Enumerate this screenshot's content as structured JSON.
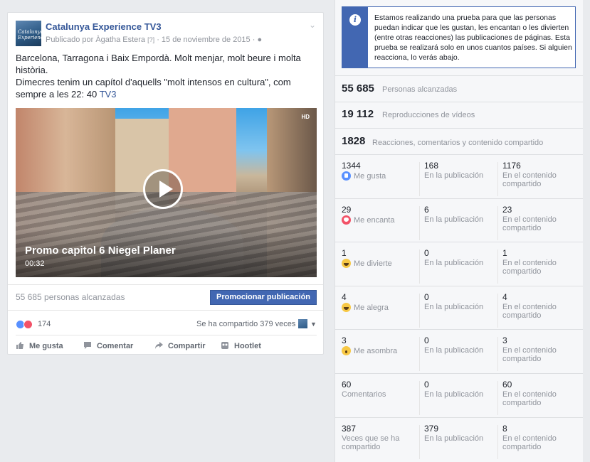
{
  "post": {
    "page_name": "Catalunya Experience TV3",
    "avatar_text": "Catalunya Experience",
    "published_by": "Publicado por Àgatha Estera",
    "date_sep": " · 15 de noviembre de 2015 ·",
    "text_line1": "Barcelona, Tarragona i Baix Empordà. Molt menjar, molt beure i molta història.",
    "text_line2": "Dimecres tenim un capítol d'aquells \"molt intensos en cultura\", com sempre a les 22: 40",
    "text_link": "TV3",
    "video": {
      "title": "Promo capitol 6 Niegel Planer",
      "duration": "00:32",
      "hd_label": "HD"
    },
    "reach_text": "55 685 personas alcanzadas",
    "promote_label": "Promocionar publicación",
    "reaction_count": "174",
    "shared_text": "Se ha compartido 379 veces",
    "actions": {
      "like": "Me gusta",
      "comment": "Comentar",
      "share": "Compartir",
      "hootlet": "Hootlet"
    }
  },
  "notice": {
    "text": "Estamos realizando una prueba para que las personas puedan indicar que les gustan, les encantan o les divierten (entre otras reacciones) las publicaciones de páginas. Esta prueba se realizará solo en unos cuantos países. Si alguien reacciona, lo verás abajo."
  },
  "summary": [
    {
      "value": "55 685",
      "label": "Personas alcanzadas"
    },
    {
      "value": "19 112",
      "label": "Reproducciones de vídeos"
    },
    {
      "value": "1828",
      "label": "Reacciones, comentarios y contenido compartido"
    }
  ],
  "breakdown": [
    {
      "icon": "like-reaction-icon",
      "total": "1344",
      "label": "Me gusta",
      "on_post": "168",
      "on_post_label": "En la publicación",
      "on_shared": "1176",
      "on_shared_label": "En el contenido compartido"
    },
    {
      "icon": "love-reaction-icon",
      "total": "29",
      "label": "Me encanta",
      "on_post": "6",
      "on_post_label": "En la publicación",
      "on_shared": "23",
      "on_shared_label": "En el contenido compartido"
    },
    {
      "icon": "haha-reaction-icon",
      "total": "1",
      "label": "Me divierte",
      "on_post": "0",
      "on_post_label": "En la publicación",
      "on_shared": "1",
      "on_shared_label": "En el contenido compartido"
    },
    {
      "icon": "yay-reaction-icon",
      "total": "4",
      "label": "Me alegra",
      "on_post": "0",
      "on_post_label": "En la publicación",
      "on_shared": "4",
      "on_shared_label": "En el contenido compartido"
    },
    {
      "icon": "wow-reaction-icon",
      "total": "3",
      "label": "Me asombra",
      "on_post": "0",
      "on_post_label": "En la publicación",
      "on_shared": "3",
      "on_shared_label": "En el contenido compartido"
    },
    {
      "icon": "",
      "total": "60",
      "label": "Comentarios",
      "on_post": "0",
      "on_post_label": "En la publicación",
      "on_shared": "60",
      "on_shared_label": "En el contenido compartido"
    },
    {
      "icon": "",
      "total": "387",
      "label": "Veces que se ha compartido",
      "on_post": "379",
      "on_post_label": "En la publicación",
      "on_shared": "8",
      "on_shared_label": "En el contenido compartido"
    }
  ]
}
